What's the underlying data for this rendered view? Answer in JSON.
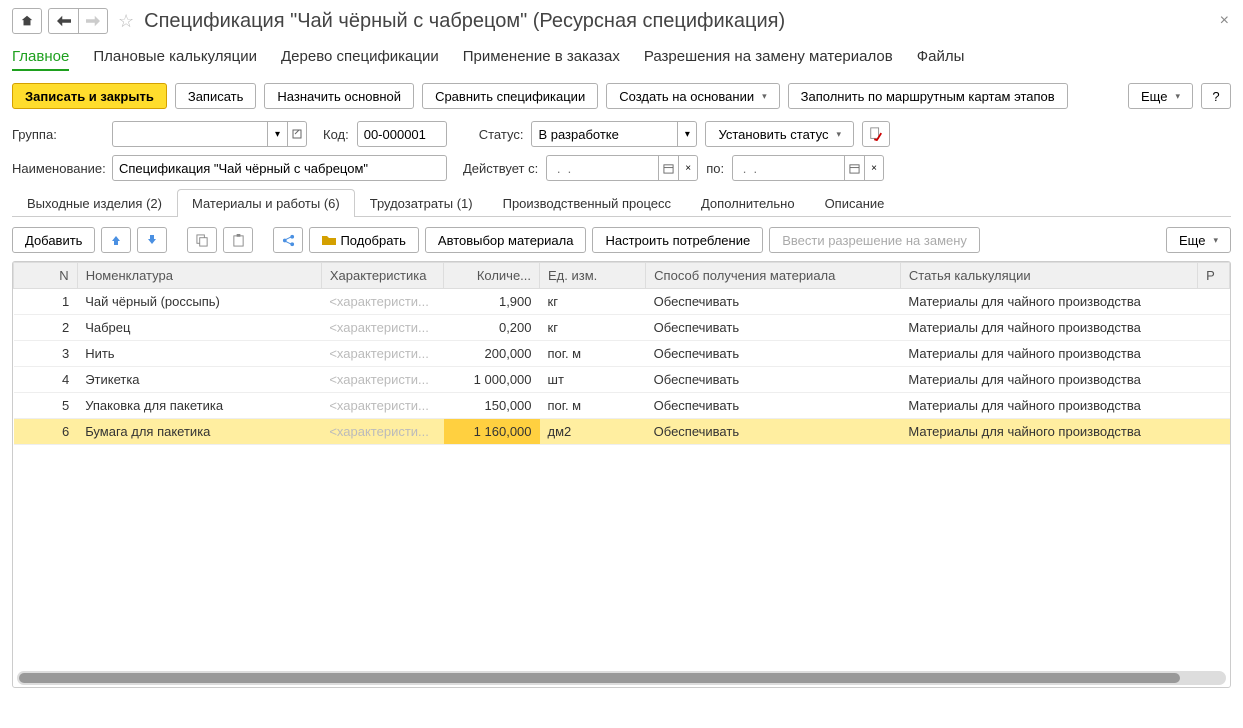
{
  "title": "Спецификация \"Чай чёрный с чабрецом\" (Ресурсная спецификация)",
  "mainTabs": {
    "t0": "Главное",
    "t1": "Плановые калькуляции",
    "t2": "Дерево спецификации",
    "t3": "Применение в заказах",
    "t4": "Разрешения на замену материалов",
    "t5": "Файлы"
  },
  "toolbar": {
    "saveClose": "Записать и закрыть",
    "save": "Записать",
    "setMain": "Назначить основной",
    "compare": "Сравнить спецификации",
    "createBased": "Создать на основании",
    "fillByRoute": "Заполнить по маршрутным картам этапов",
    "more": "Еще",
    "help": "?"
  },
  "form": {
    "groupLabel": "Группа:",
    "codeLabel": "Код:",
    "codeValue": "00-000001",
    "statusLabel": "Статус:",
    "statusValue": "В разработке",
    "setStatus": "Установить статус",
    "nameLabel": "Наименование:",
    "nameValue": "Спецификация \"Чай чёрный с чабрецом\"",
    "validFromLabel": "Действует с:",
    "toLabel": "по:",
    "datePlaceholder": " .  .    "
  },
  "subTabs": {
    "s0": "Выходные изделия (2)",
    "s1": "Материалы и работы (6)",
    "s2": "Трудозатраты (1)",
    "s3": "Производственный процесс",
    "s4": "Дополнительно",
    "s5": "Описание"
  },
  "tabToolbar": {
    "add": "Добавить",
    "pick": "Подобрать",
    "autoSelect": "Автовыбор материала",
    "configure": "Настроить потребление",
    "permission": "Ввести разрешение на замену",
    "more": "Еще"
  },
  "columns": {
    "n": "N",
    "nomen": "Номенклатура",
    "char": "Характеристика",
    "qty": "Количе...",
    "unit": "Ед. изм.",
    "method": "Способ получения материала",
    "article": "Статья калькуляции",
    "r": "Р"
  },
  "charPlaceholder": "<характеристи...",
  "rows": {
    "r0": {
      "n": "1",
      "nomen": "Чай чёрный (россыпь)",
      "qty": "1,900",
      "unit": "кг",
      "method": "Обеспечивать",
      "article": "Материалы для чайного производства"
    },
    "r1": {
      "n": "2",
      "nomen": "Чабрец",
      "qty": "0,200",
      "unit": "кг",
      "method": "Обеспечивать",
      "article": "Материалы для чайного производства"
    },
    "r2": {
      "n": "3",
      "nomen": "Нить",
      "qty": "200,000",
      "unit": "пог. м",
      "method": "Обеспечивать",
      "article": "Материалы для чайного производства"
    },
    "r3": {
      "n": "4",
      "nomen": "Этикетка",
      "qty": "1 000,000",
      "unit": "шт",
      "method": "Обеспечивать",
      "article": "Материалы для чайного производства"
    },
    "r4": {
      "n": "5",
      "nomen": "Упаковка для пакетика",
      "qty": "150,000",
      "unit": "пог. м",
      "method": "Обеспечивать",
      "article": "Материалы для чайного производства"
    },
    "r5": {
      "n": "6",
      "nomen": "Бумага для пакетика",
      "qty": "1 160,000",
      "unit": "дм2",
      "method": "Обеспечивать",
      "article": "Материалы для чайного производства"
    }
  }
}
